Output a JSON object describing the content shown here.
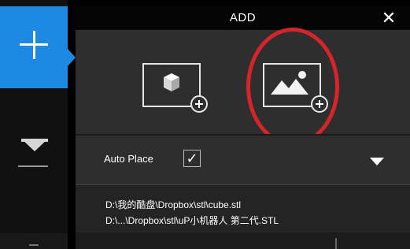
{
  "panel": {
    "title": "ADD",
    "close_icon": "close-icon"
  },
  "toolbar": {
    "add_icon": "plus-icon",
    "layflat_icon": "layflat-icon"
  },
  "options": {
    "add_model_icon": "cube-plus-icon",
    "add_image_icon": "image-plus-icon",
    "highlight_color": "#d3252a"
  },
  "auto_place": {
    "label": "Auto Place",
    "checked_glyph": "✓"
  },
  "recent_files": [
    "D:\\我的酷盘\\Dropbox\\stl\\cube.stl",
    "D:\\...\\Dropbox\\stl\\uP小机器人 第二代.STL"
  ],
  "colors": {
    "accent": "#1e88e5",
    "panel_bg": "#2e2e2e",
    "header_bg": "#050505"
  }
}
